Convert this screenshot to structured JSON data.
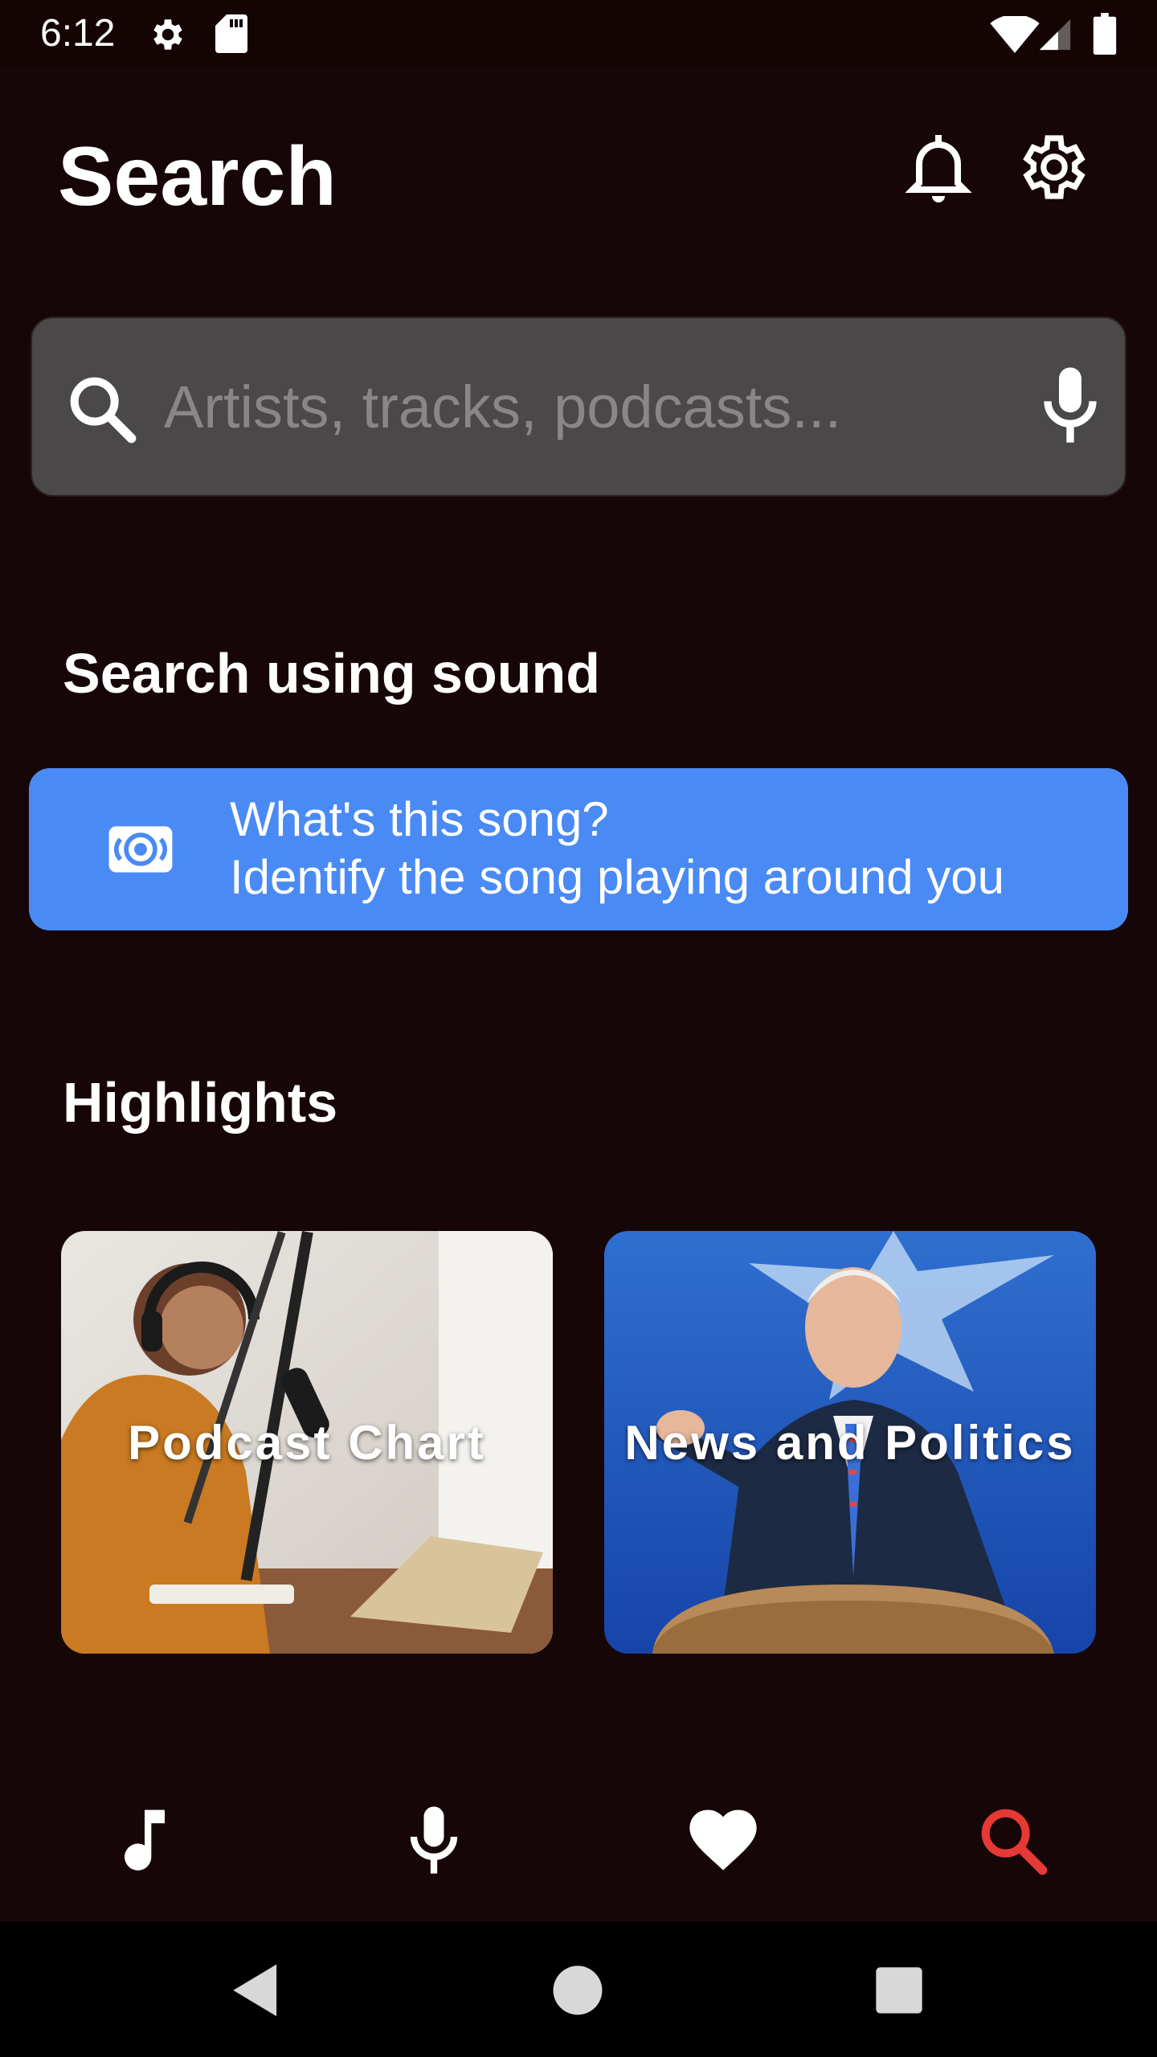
{
  "status_bar": {
    "time": "6:12"
  },
  "header": {
    "title": "Search"
  },
  "search": {
    "placeholder": "Artists, tracks, podcasts..."
  },
  "sound_section": {
    "title": "Search using sound",
    "card_title": "What's this song?",
    "card_subtitle": "Identify the song playing around you"
  },
  "highlights": {
    "title": "Highlights",
    "items": [
      {
        "label": "Podcast Chart"
      },
      {
        "label": "News and Politics"
      }
    ]
  },
  "bottom_nav": {
    "items": [
      {
        "icon": "music-note-icon",
        "active": false
      },
      {
        "icon": "microphone-icon",
        "active": false
      },
      {
        "icon": "heart-icon",
        "active": false
      },
      {
        "icon": "search-icon",
        "active": true
      }
    ]
  },
  "colors": {
    "background": "#170607",
    "accent_blue": "#4a8af4",
    "active_nav": "#e53935",
    "search_box": "#4a4848"
  }
}
